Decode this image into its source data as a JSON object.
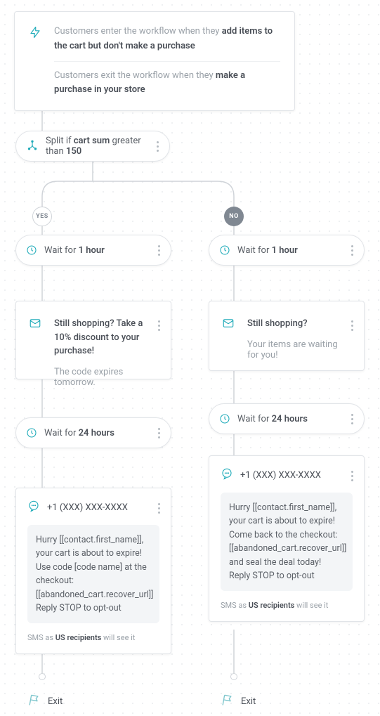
{
  "trigger": {
    "enter_prefix": "Customers enter the workflow when they ",
    "enter_strong": "add items to the cart but don't make a purchase",
    "exit_prefix": "Customers exit the workflow when they ",
    "exit_strong": "make a purchase in your store"
  },
  "split": {
    "prefix": "Split if ",
    "field": "cart sum",
    "mid": " greater than ",
    "value": "150"
  },
  "badges": {
    "yes": "YES",
    "no": "NO"
  },
  "yes_branch": {
    "wait1_prefix": "Wait for ",
    "wait1_value": "1 hour",
    "email_subject": "Still shopping? Take a 10% discount to your purchase!",
    "email_body": "The code expires tomorrow.",
    "wait24_prefix": "Wait for ",
    "wait24_value": "24 hours",
    "sms_from": "+1 (XXX) XXX-XXXX",
    "sms_body": "Hurry [[contact.first_name]], your cart is about to expire! Use code [code name] at the checkout: [[abandoned_cart.recover_url]] Reply STOP to opt-out",
    "sms_note_prefix": "SMS as ",
    "sms_note_strong": "US recipients",
    "sms_note_suffix": " will see it",
    "exit_label": "Exit"
  },
  "no_branch": {
    "wait1_prefix": "Wait for ",
    "wait1_value": "1 hour",
    "email_subject": "Still shopping?",
    "email_body": "Your items are waiting for you!",
    "wait24_prefix": "Wait for ",
    "wait24_value": "24 hours",
    "sms_from": "+1 (XXX) XXX-XXXX",
    "sms_body": "Hurry [[contact.first_name]], your cart is about to expire! Come back to the checkout: [[abandoned_cart.recover_url]] and seal the deal today! Reply STOP to opt-out",
    "sms_note_prefix": "SMS as ",
    "sms_note_strong": "US recipients",
    "sms_note_suffix": " will see it",
    "exit_label": "Exit"
  },
  "colors": {
    "accent": "#1caab8"
  }
}
